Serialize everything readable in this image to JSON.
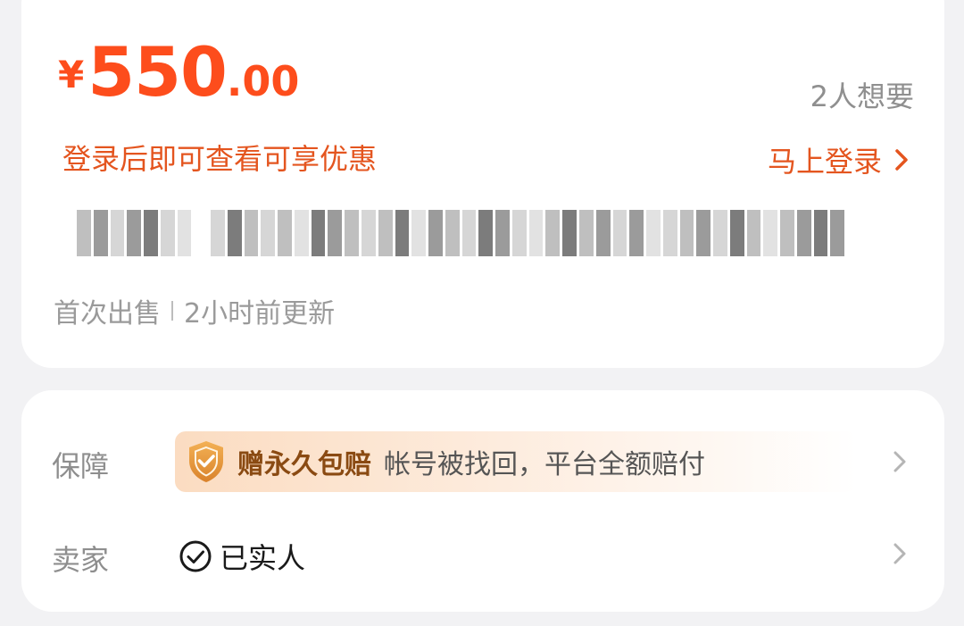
{
  "price": {
    "currency": "¥",
    "integer": "550",
    "decimal": ".00"
  },
  "want_count": "2人想要",
  "promo_text": "登录后即可查看可享优惠",
  "login_link": "马上登录",
  "meta": {
    "first_sale": "首次出售",
    "updated": "2小时前更新"
  },
  "guarantee": {
    "label": "保障",
    "title": "赠永久包赔",
    "description": "帐号被找回，平台全额赔付"
  },
  "seller": {
    "label": "卖家",
    "verified_text": "已实人"
  },
  "colors": {
    "price": "#fd4d1c",
    "promo": "#e4551f",
    "guarantee_title": "#8a4a12"
  },
  "icons": {
    "chevron_login": "chevron-right-icon",
    "shield": "shield-check-icon",
    "verified": "check-circle-icon",
    "chevron_row": "chevron-right-icon"
  }
}
